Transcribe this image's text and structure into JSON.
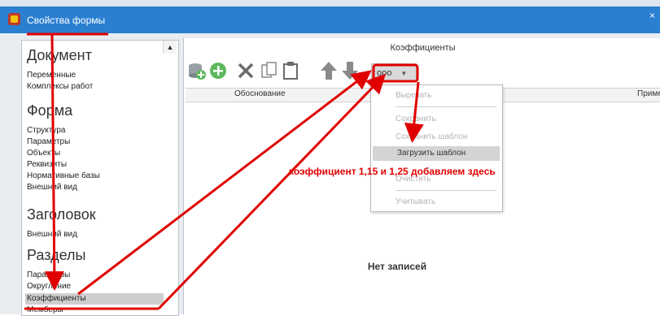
{
  "window": {
    "title": "Свойства формы",
    "close_glyph": "×"
  },
  "sections": [
    {
      "title": "Документ",
      "items": [
        "Переменные",
        "Комплексы работ"
      ]
    },
    {
      "title": "Форма",
      "items": [
        "Структура",
        "Параметры",
        "Объекты",
        "Реквизиты",
        "Нормативные базы",
        "Внешний вид"
      ]
    },
    {
      "title": "Заголовок",
      "items": [
        "Внешний вид"
      ]
    },
    {
      "title": "Разделы",
      "items": [
        "Параметры",
        "Округление",
        "Коэффициенты",
        "Мемберы"
      ]
    }
  ],
  "selected_item": "Коэффициенты",
  "right": {
    "header": "Коэффициенты",
    "more_button_label": "ooo",
    "columns": [
      "Обоснование",
      "Примен"
    ],
    "empty_text": "Нет записей"
  },
  "menu": {
    "items": [
      {
        "label": "Вырезать",
        "enabled": false
      },
      {
        "label": "Сохранить",
        "enabled": false
      },
      {
        "label": "Сохранить шаблон",
        "enabled": false
      },
      {
        "label": "Загрузить шаблон",
        "enabled": true
      },
      {
        "label": "Очистить",
        "enabled": false
      },
      {
        "label": "Учитывать",
        "enabled": false
      }
    ]
  },
  "annotation": {
    "text": "коэффициент 1,15 и 1,25 добавляем здесь",
    "color": "#e00000"
  },
  "colors": {
    "titlebar": "#2b7fd0",
    "annotation_red": "#e00000",
    "selection": "#cfcfcf"
  },
  "icons": [
    "app-icon",
    "database-add-icon",
    "add-icon",
    "delete-icon",
    "copy-icon",
    "paste-icon",
    "arrow-up-icon",
    "arrow-down-icon",
    "chevron-down-icon",
    "scroll-up-icon"
  ]
}
